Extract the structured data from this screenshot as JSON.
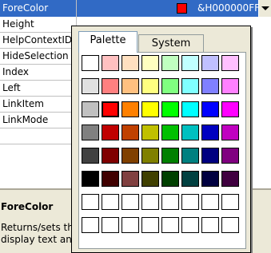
{
  "grid": {
    "selected": {
      "name": "ForeColor",
      "value": "&H000000FF&",
      "swatch": "#ff0000"
    },
    "rows": [
      "Height",
      "HelpContextID",
      "HideSelection",
      "Index",
      "Left",
      "LinkItem",
      "LinkMode",
      ""
    ]
  },
  "picker": {
    "tabs": [
      "Palette",
      "System"
    ],
    "selected_index": 17,
    "colors": [
      "#ffffff",
      "#ffc0c0",
      "#ffe0c0",
      "#ffffc0",
      "#c0ffc0",
      "#c0ffff",
      "#c0c0ff",
      "#ffc0ff",
      "#e0e0e0",
      "#ff8080",
      "#ffc080",
      "#ffff80",
      "#80ff80",
      "#80ffff",
      "#8080ff",
      "#ff80ff",
      "#c0c0c0",
      "#ff0000",
      "#ff8000",
      "#ffff00",
      "#00ff00",
      "#00ffff",
      "#0000ff",
      "#ff00ff",
      "#808080",
      "#c00000",
      "#c04000",
      "#c0c000",
      "#00c000",
      "#00c0c0",
      "#0000c0",
      "#c000c0",
      "#404040",
      "#800000",
      "#804000",
      "#808000",
      "#008000",
      "#008080",
      "#000080",
      "#800080",
      "#000000",
      "#400000",
      "#804040",
      "#404000",
      "#004000",
      "#004040",
      "#000040",
      "#400040",
      "#ffffff",
      "#ffffff",
      "#ffffff",
      "#ffffff",
      "#ffffff",
      "#ffffff",
      "#ffffff",
      "#ffffff",
      "#ffffff",
      "#ffffff",
      "#ffffff",
      "#ffffff",
      "#ffffff",
      "#ffffff",
      "#ffffff",
      "#ffffff"
    ]
  },
  "description": {
    "title": "ForeColor",
    "line1": "Returns/sets the foreground color used to",
    "line2": "display text and graphics in an object."
  }
}
